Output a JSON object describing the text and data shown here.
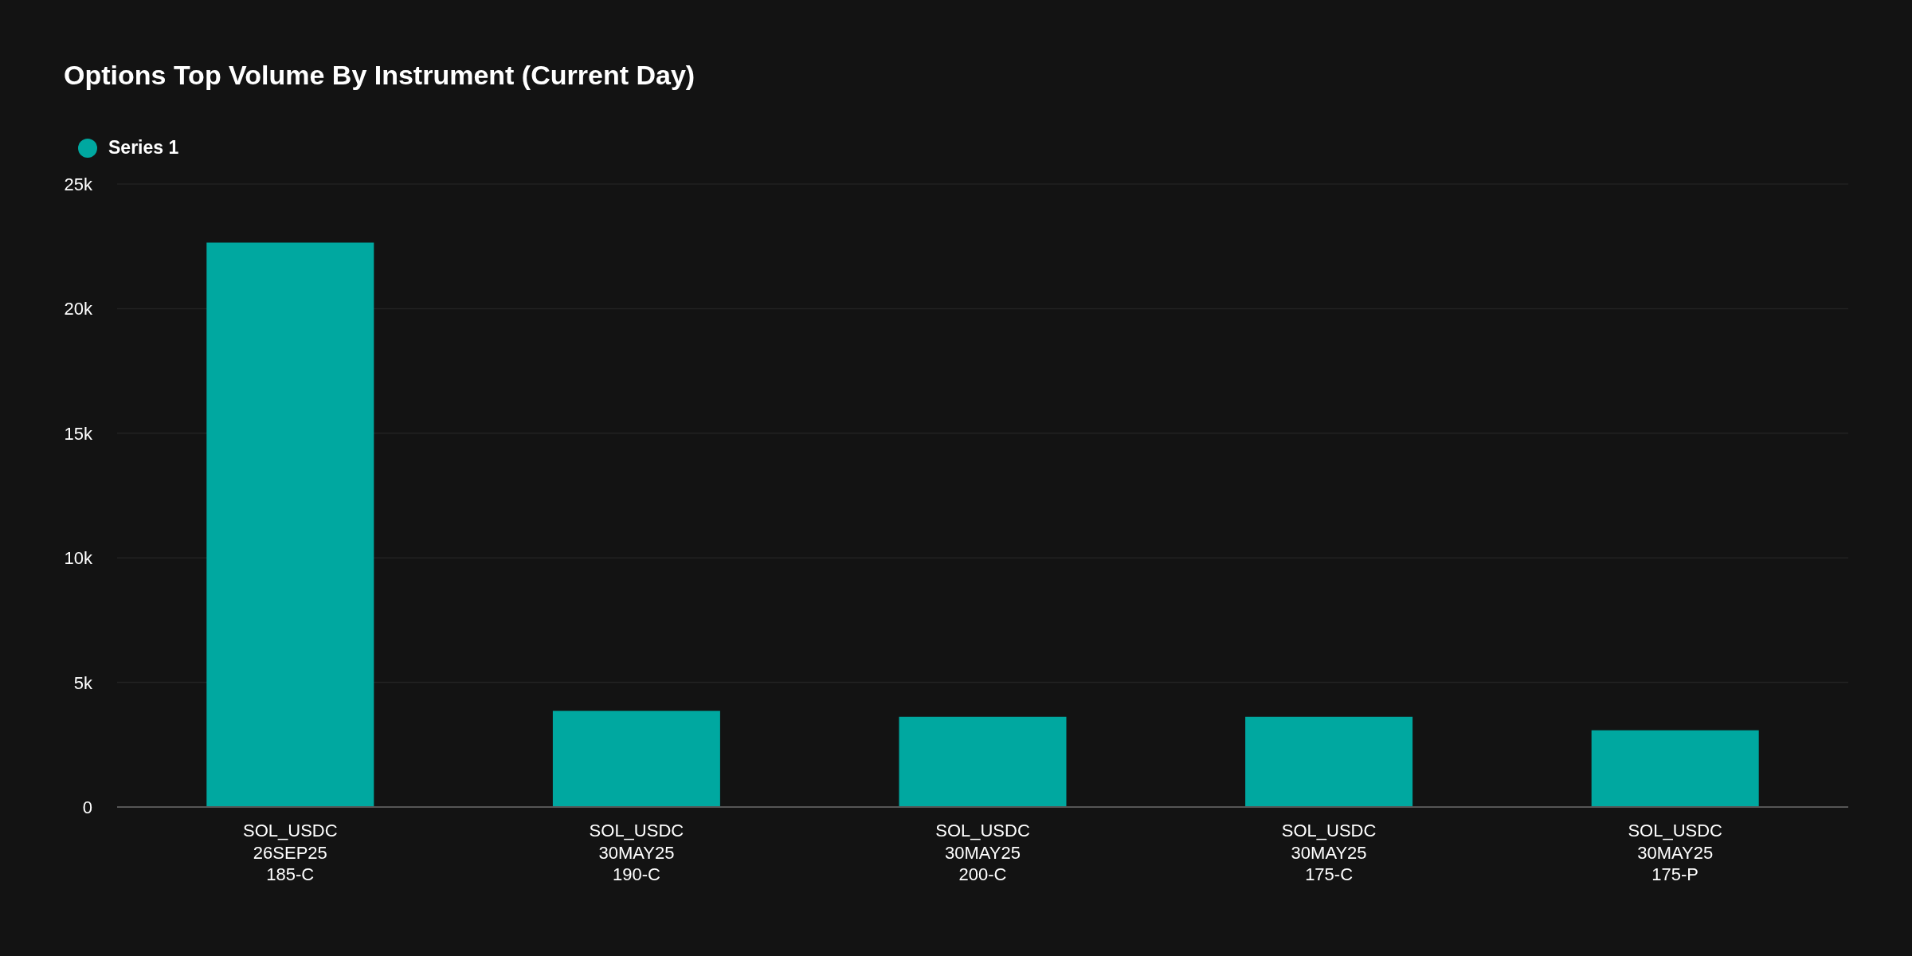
{
  "chart_data": {
    "type": "bar",
    "title": "Options Top Volume By Instrument (Current Day)",
    "categories": [
      "SOL_USDC\n26SEP25\n185-C",
      "SOL_USDC\n30MAY25\n190-C",
      "SOL_USDC\n30MAY25\n200-C",
      "SOL_USDC\n30MAY25\n175-C",
      "SOL_USDC\n30MAY25\n175-P"
    ],
    "series": [
      {
        "name": "Series 1",
        "color": "#00a8a0",
        "values": [
          22650,
          3860,
          3620,
          3620,
          3080
        ]
      }
    ],
    "ylim": [
      0,
      25000
    ],
    "grid": true,
    "yticks": [
      {
        "value": 0,
        "label": "0"
      },
      {
        "value": 5000,
        "label": "5k"
      },
      {
        "value": 10000,
        "label": "10k"
      },
      {
        "value": 15000,
        "label": "15k"
      },
      {
        "value": 20000,
        "label": "20k"
      },
      {
        "value": 25000,
        "label": "25k"
      }
    ]
  }
}
